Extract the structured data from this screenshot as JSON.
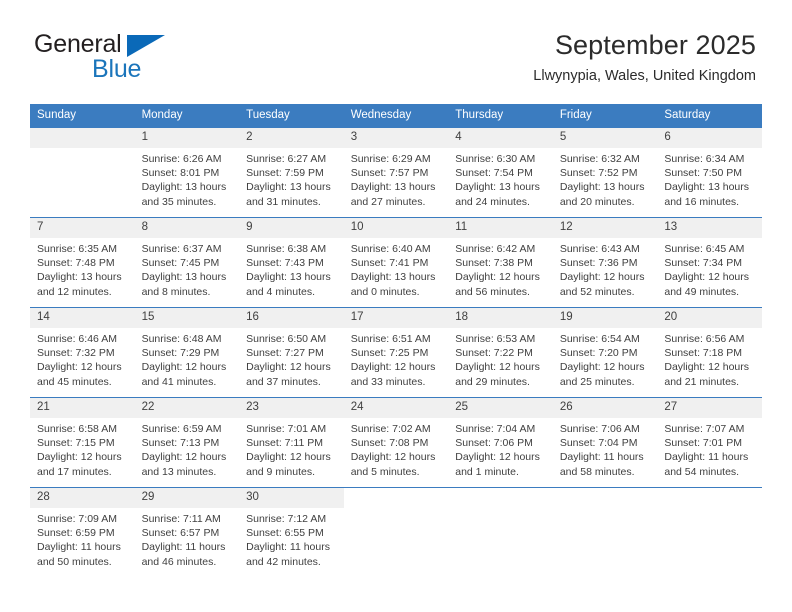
{
  "brand": {
    "name_part1": "General",
    "name_part2": "Blue"
  },
  "header": {
    "title": "September 2025",
    "subtitle": "Llwynypia, Wales, United Kingdom"
  },
  "calendar": {
    "weekday_headers": [
      "Sunday",
      "Monday",
      "Tuesday",
      "Wednesday",
      "Thursday",
      "Friday",
      "Saturday"
    ],
    "accent_color": "#3b7cc0",
    "daynum_band_color": "#f0f0f0",
    "weeks": [
      [
        {
          "day": "",
          "empty": true
        },
        {
          "day": "1",
          "sunrise": "Sunrise: 6:26 AM",
          "sunset": "Sunset: 8:01 PM",
          "daylight_line1": "Daylight: 13 hours",
          "daylight_line2": "and 35 minutes."
        },
        {
          "day": "2",
          "sunrise": "Sunrise: 6:27 AM",
          "sunset": "Sunset: 7:59 PM",
          "daylight_line1": "Daylight: 13 hours",
          "daylight_line2": "and 31 minutes."
        },
        {
          "day": "3",
          "sunrise": "Sunrise: 6:29 AM",
          "sunset": "Sunset: 7:57 PM",
          "daylight_line1": "Daylight: 13 hours",
          "daylight_line2": "and 27 minutes."
        },
        {
          "day": "4",
          "sunrise": "Sunrise: 6:30 AM",
          "sunset": "Sunset: 7:54 PM",
          "daylight_line1": "Daylight: 13 hours",
          "daylight_line2": "and 24 minutes."
        },
        {
          "day": "5",
          "sunrise": "Sunrise: 6:32 AM",
          "sunset": "Sunset: 7:52 PM",
          "daylight_line1": "Daylight: 13 hours",
          "daylight_line2": "and 20 minutes."
        },
        {
          "day": "6",
          "sunrise": "Sunrise: 6:34 AM",
          "sunset": "Sunset: 7:50 PM",
          "daylight_line1": "Daylight: 13 hours",
          "daylight_line2": "and 16 minutes."
        }
      ],
      [
        {
          "day": "7",
          "sunrise": "Sunrise: 6:35 AM",
          "sunset": "Sunset: 7:48 PM",
          "daylight_line1": "Daylight: 13 hours",
          "daylight_line2": "and 12 minutes."
        },
        {
          "day": "8",
          "sunrise": "Sunrise: 6:37 AM",
          "sunset": "Sunset: 7:45 PM",
          "daylight_line1": "Daylight: 13 hours",
          "daylight_line2": "and 8 minutes."
        },
        {
          "day": "9",
          "sunrise": "Sunrise: 6:38 AM",
          "sunset": "Sunset: 7:43 PM",
          "daylight_line1": "Daylight: 13 hours",
          "daylight_line2": "and 4 minutes."
        },
        {
          "day": "10",
          "sunrise": "Sunrise: 6:40 AM",
          "sunset": "Sunset: 7:41 PM",
          "daylight_line1": "Daylight: 13 hours",
          "daylight_line2": "and 0 minutes."
        },
        {
          "day": "11",
          "sunrise": "Sunrise: 6:42 AM",
          "sunset": "Sunset: 7:38 PM",
          "daylight_line1": "Daylight: 12 hours",
          "daylight_line2": "and 56 minutes."
        },
        {
          "day": "12",
          "sunrise": "Sunrise: 6:43 AM",
          "sunset": "Sunset: 7:36 PM",
          "daylight_line1": "Daylight: 12 hours",
          "daylight_line2": "and 52 minutes."
        },
        {
          "day": "13",
          "sunrise": "Sunrise: 6:45 AM",
          "sunset": "Sunset: 7:34 PM",
          "daylight_line1": "Daylight: 12 hours",
          "daylight_line2": "and 49 minutes."
        }
      ],
      [
        {
          "day": "14",
          "sunrise": "Sunrise: 6:46 AM",
          "sunset": "Sunset: 7:32 PM",
          "daylight_line1": "Daylight: 12 hours",
          "daylight_line2": "and 45 minutes."
        },
        {
          "day": "15",
          "sunrise": "Sunrise: 6:48 AM",
          "sunset": "Sunset: 7:29 PM",
          "daylight_line1": "Daylight: 12 hours",
          "daylight_line2": "and 41 minutes."
        },
        {
          "day": "16",
          "sunrise": "Sunrise: 6:50 AM",
          "sunset": "Sunset: 7:27 PM",
          "daylight_line1": "Daylight: 12 hours",
          "daylight_line2": "and 37 minutes."
        },
        {
          "day": "17",
          "sunrise": "Sunrise: 6:51 AM",
          "sunset": "Sunset: 7:25 PM",
          "daylight_line1": "Daylight: 12 hours",
          "daylight_line2": "and 33 minutes."
        },
        {
          "day": "18",
          "sunrise": "Sunrise: 6:53 AM",
          "sunset": "Sunset: 7:22 PM",
          "daylight_line1": "Daylight: 12 hours",
          "daylight_line2": "and 29 minutes."
        },
        {
          "day": "19",
          "sunrise": "Sunrise: 6:54 AM",
          "sunset": "Sunset: 7:20 PM",
          "daylight_line1": "Daylight: 12 hours",
          "daylight_line2": "and 25 minutes."
        },
        {
          "day": "20",
          "sunrise": "Sunrise: 6:56 AM",
          "sunset": "Sunset: 7:18 PM",
          "daylight_line1": "Daylight: 12 hours",
          "daylight_line2": "and 21 minutes."
        }
      ],
      [
        {
          "day": "21",
          "sunrise": "Sunrise: 6:58 AM",
          "sunset": "Sunset: 7:15 PM",
          "daylight_line1": "Daylight: 12 hours",
          "daylight_line2": "and 17 minutes."
        },
        {
          "day": "22",
          "sunrise": "Sunrise: 6:59 AM",
          "sunset": "Sunset: 7:13 PM",
          "daylight_line1": "Daylight: 12 hours",
          "daylight_line2": "and 13 minutes."
        },
        {
          "day": "23",
          "sunrise": "Sunrise: 7:01 AM",
          "sunset": "Sunset: 7:11 PM",
          "daylight_line1": "Daylight: 12 hours",
          "daylight_line2": "and 9 minutes."
        },
        {
          "day": "24",
          "sunrise": "Sunrise: 7:02 AM",
          "sunset": "Sunset: 7:08 PM",
          "daylight_line1": "Daylight: 12 hours",
          "daylight_line2": "and 5 minutes."
        },
        {
          "day": "25",
          "sunrise": "Sunrise: 7:04 AM",
          "sunset": "Sunset: 7:06 PM",
          "daylight_line1": "Daylight: 12 hours",
          "daylight_line2": "and 1 minute."
        },
        {
          "day": "26",
          "sunrise": "Sunrise: 7:06 AM",
          "sunset": "Sunset: 7:04 PM",
          "daylight_line1": "Daylight: 11 hours",
          "daylight_line2": "and 58 minutes."
        },
        {
          "day": "27",
          "sunrise": "Sunrise: 7:07 AM",
          "sunset": "Sunset: 7:01 PM",
          "daylight_line1": "Daylight: 11 hours",
          "daylight_line2": "and 54 minutes."
        }
      ],
      [
        {
          "day": "28",
          "sunrise": "Sunrise: 7:09 AM",
          "sunset": "Sunset: 6:59 PM",
          "daylight_line1": "Daylight: 11 hours",
          "daylight_line2": "and 50 minutes."
        },
        {
          "day": "29",
          "sunrise": "Sunrise: 7:11 AM",
          "sunset": "Sunset: 6:57 PM",
          "daylight_line1": "Daylight: 11 hours",
          "daylight_line2": "and 46 minutes."
        },
        {
          "day": "30",
          "sunrise": "Sunrise: 7:12 AM",
          "sunset": "Sunset: 6:55 PM",
          "daylight_line1": "Daylight: 11 hours",
          "daylight_line2": "and 42 minutes."
        },
        {
          "day": "",
          "blank": true
        },
        {
          "day": "",
          "blank": true
        },
        {
          "day": "",
          "blank": true
        },
        {
          "day": "",
          "blank": true
        }
      ]
    ]
  }
}
